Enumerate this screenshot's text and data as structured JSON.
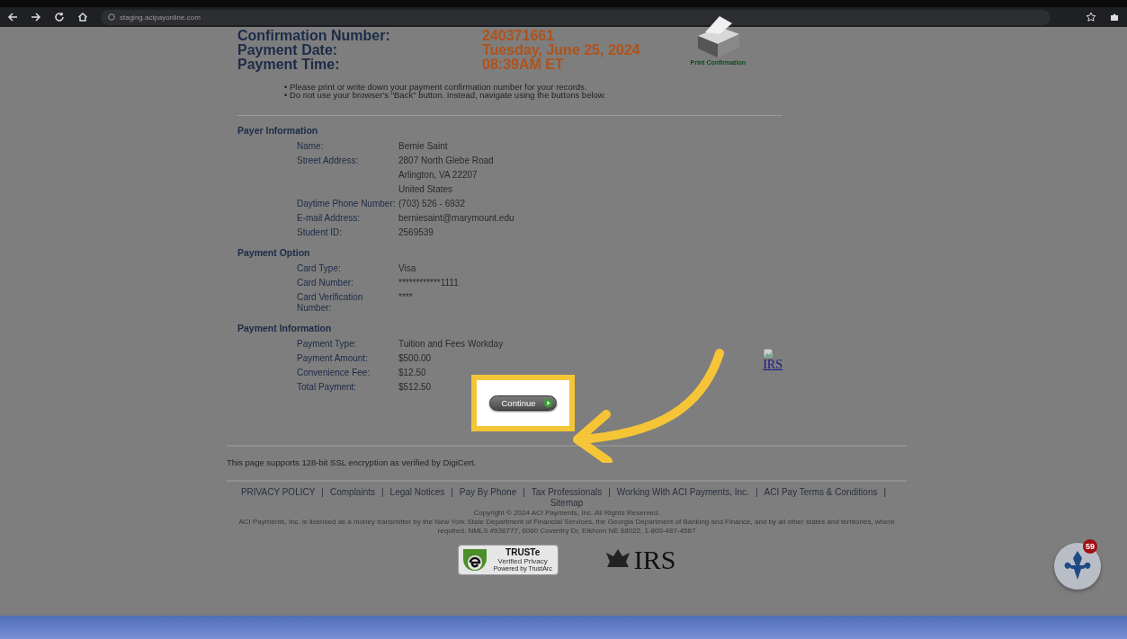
{
  "browser": {
    "url": "staging.acipayonline.com"
  },
  "confirmation": [
    {
      "label": "Confirmation Number:",
      "value": "240371661"
    },
    {
      "label": "Payment Date:",
      "value": "Tuesday, June 25, 2024"
    },
    {
      "label": "Payment Time:",
      "value": "08:39AM ET"
    }
  ],
  "print_label": "Print Confirmation",
  "notes": [
    "• Please print or write down your payment confirmation number for your records.",
    "• Do not use your browser's \"Back\" button. Instead, navigate using the buttons below."
  ],
  "sections": [
    {
      "title": "Payer Information",
      "rows": [
        {
          "label": "Name:",
          "values": [
            "Bernie Saint"
          ]
        },
        {
          "label": "Street Address:",
          "values": [
            "2807 North Glebe Road",
            "Arlington, VA 22207",
            "United States"
          ]
        },
        {
          "label": "Daytime Phone Number:",
          "values": [
            "(703) 526 - 6932"
          ]
        },
        {
          "label": "E-mail Address:",
          "values": [
            "berniesaint@marymount.edu"
          ]
        },
        {
          "label": "Student ID:",
          "values": [
            "2569539"
          ]
        }
      ]
    },
    {
      "title": "Payment Option",
      "rows": [
        {
          "label": "Card Type:",
          "values": [
            "Visa"
          ]
        },
        {
          "label": "Card Number:",
          "values": [
            "************1111"
          ]
        },
        {
          "label": "Card Verification Number:",
          "values": [
            "****"
          ]
        }
      ]
    },
    {
      "title": "Payment Information",
      "rows": [
        {
          "label": "Payment Type:",
          "values": [
            "Tuition and Fees Workday"
          ]
        },
        {
          "label": "Payment Amount:",
          "values": [
            "$500.00"
          ]
        },
        {
          "label": "Convenience Fee:",
          "values": [
            "$12.50"
          ]
        },
        {
          "label": "Total Payment:",
          "values": [
            "$512.50"
          ]
        }
      ]
    }
  ],
  "irs_link": "IRS",
  "continue_button": "Continue",
  "ssl_note": "This page supports 128-bit SSL encryption as verified by DigiCert.",
  "footer_links": [
    "PRIVACY POLICY",
    "Complaints",
    "Legal Notices",
    "Pay By Phone",
    "Tax Professionals",
    "Working With ACI Payments, Inc.",
    "ACI Pay Terms & Conditions",
    "Sitemap"
  ],
  "footer_separator": "|",
  "copyright": "Copyright © 2024 ACI Payments, Inc. All Rights Reserved.",
  "license": "ACI Payments, Inc. is licensed as a money transmitter by the New York State Department of Financial Services, the Georgia Department of Banking and Finance, and by all other states and territories, where required. NMLS #936777, 6060 Coventry Dr, Elkhorn NE 68022, 1-800-487-4567",
  "trust_badge": {
    "title": "TRUSTe",
    "subtitle": "Verified Privacy",
    "powered": "Powered by TrustArc"
  },
  "irs_logo": "IRS",
  "chat_badge": {
    "count": "59"
  }
}
